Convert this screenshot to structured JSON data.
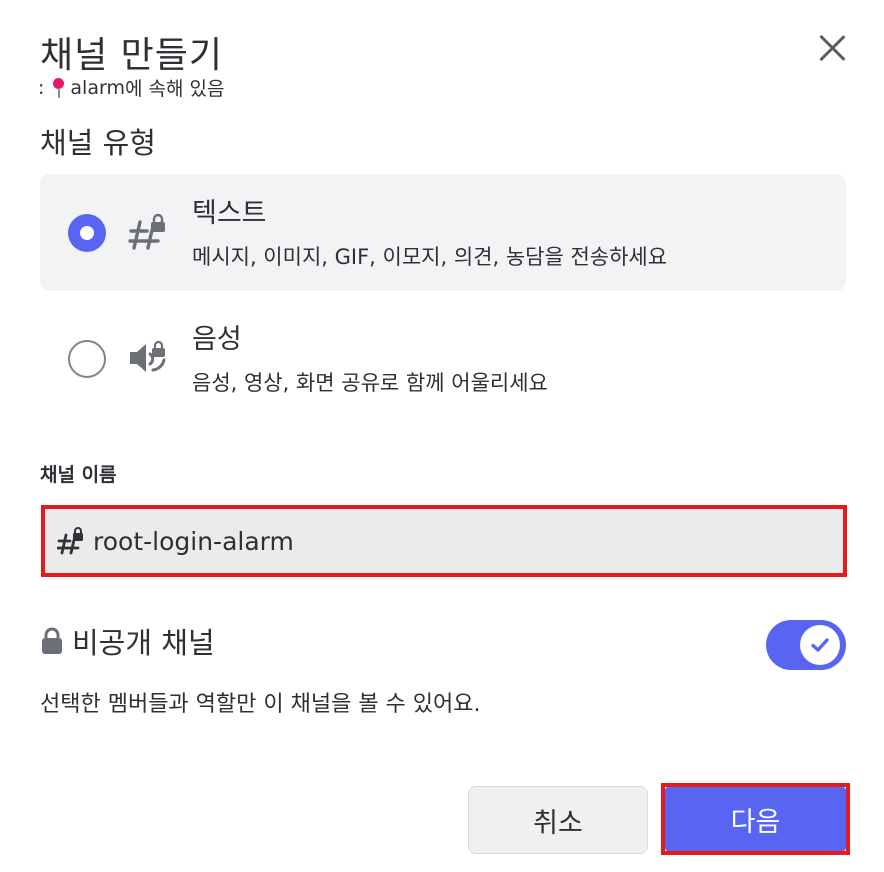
{
  "dialog": {
    "title": "채널 만들기",
    "subtitle_prefix": ":",
    "category_name": "alarm",
    "subtitle_suffix": "에 속해 있음"
  },
  "channel_type": {
    "heading": "채널 유형",
    "options": [
      {
        "label": "텍스트",
        "description": "메시지, 이미지, GIF, 이모지, 의견, 농담을 전송하세요",
        "selected": true,
        "icon": "hash-lock-icon"
      },
      {
        "label": "음성",
        "description": "음성, 영상, 화면 공유로 함께 어울리세요",
        "selected": false,
        "icon": "speaker-lock-icon"
      }
    ]
  },
  "channel_name": {
    "label": "채널 이름",
    "value": "root-login-alarm",
    "icon": "hash-lock-icon"
  },
  "private_channel": {
    "label": "비공개 채널",
    "enabled": true,
    "description": "선택한 멤버들과 역할만 이 채널을 볼 수 있어요."
  },
  "buttons": {
    "cancel": "취소",
    "next": "다음"
  },
  "colors": {
    "accent": "#5865f2",
    "highlight_border": "#e51b1b",
    "pin": "#e8186b"
  }
}
